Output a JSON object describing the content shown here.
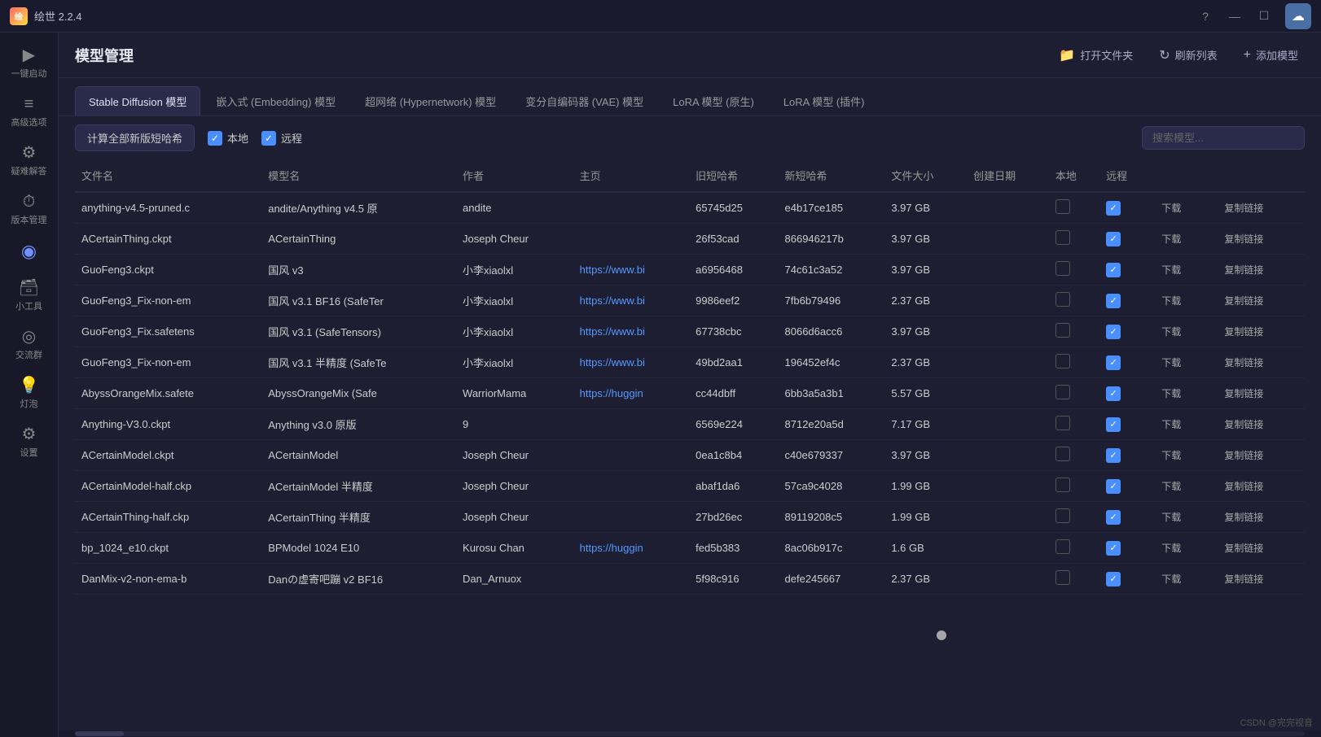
{
  "titlebar": {
    "title": "绘世 2.2.4",
    "controls": [
      "?",
      "—",
      "☐"
    ]
  },
  "sidebar": {
    "items": [
      {
        "id": "launch",
        "icon": "▶",
        "label": "一键启动"
      },
      {
        "id": "advanced",
        "icon": "≡",
        "label": "高级选项"
      },
      {
        "id": "troubleshoot",
        "icon": "⚙",
        "label": "疑难解答"
      },
      {
        "id": "version",
        "icon": "⏱",
        "label": "版本管理"
      },
      {
        "id": "models",
        "icon": "◉",
        "label": "",
        "active": true
      },
      {
        "id": "tools",
        "icon": "🗃",
        "label": "小工具"
      },
      {
        "id": "community",
        "icon": "◎",
        "label": "交流群"
      },
      {
        "id": "ideas",
        "icon": "💡",
        "label": "灯泡"
      },
      {
        "id": "settings",
        "icon": "⚙",
        "label": "设置"
      }
    ]
  },
  "header": {
    "title": "模型管理",
    "actions": [
      {
        "id": "open-folder",
        "icon": "📁",
        "label": "打开文件夹"
      },
      {
        "id": "refresh",
        "icon": "↻",
        "label": "刷新列表"
      },
      {
        "id": "add-model",
        "icon": "+",
        "label": "添加模型"
      }
    ]
  },
  "tabs": [
    {
      "id": "stable-diffusion",
      "label": "Stable Diffusion 模型",
      "active": true
    },
    {
      "id": "embedding",
      "label": "嵌入式 (Embedding) 模型"
    },
    {
      "id": "hypernetwork",
      "label": "超网络 (Hypernetwork) 模型"
    },
    {
      "id": "vae",
      "label": "变分自编码器 (VAE) 模型"
    },
    {
      "id": "lora-native",
      "label": "LoRA 模型 (原生)"
    },
    {
      "id": "lora-plugin",
      "label": "LoRA 模型 (插件)"
    }
  ],
  "toolbar": {
    "calc_btn": "计算全部新版短哈希",
    "local_label": "本地",
    "remote_label": "远程",
    "search_placeholder": "搜索模型..."
  },
  "table": {
    "columns": [
      "文件名",
      "模型名",
      "作者",
      "主页",
      "旧短哈希",
      "新短哈希",
      "文件大小",
      "创建日期",
      "本地",
      "远程",
      "",
      ""
    ],
    "rows": [
      {
        "filename": "anything-v4.5-pruned.c",
        "modelname": "andite/Anything v4.5 原",
        "author": "andite",
        "homepage": "",
        "old_hash": "65745d25",
        "new_hash": "e4b17ce185",
        "size": "3.97 GB",
        "date": "",
        "local": false,
        "remote": true
      },
      {
        "filename": "ACertainThing.ckpt",
        "modelname": "ACertainThing",
        "author": "Joseph Cheur",
        "homepage": "",
        "old_hash": "26f53cad",
        "new_hash": "866946217b",
        "size": "3.97 GB",
        "date": "",
        "local": false,
        "remote": true
      },
      {
        "filename": "GuoFeng3.ckpt",
        "modelname": "国风 v3",
        "author": "小李xiaolxl",
        "homepage": "https://www.bi",
        "old_hash": "a6956468",
        "new_hash": "74c61c3a52",
        "size": "3.97 GB",
        "date": "",
        "local": false,
        "remote": true
      },
      {
        "filename": "GuoFeng3_Fix-non-em",
        "modelname": "国风 v3.1 BF16 (SafeTer",
        "author": "小李xiaolxl",
        "homepage": "https://www.bi",
        "old_hash": "9986eef2",
        "new_hash": "7fb6b79496",
        "size": "2.37 GB",
        "date": "",
        "local": false,
        "remote": true
      },
      {
        "filename": "GuoFeng3_Fix.safetens",
        "modelname": "国风 v3.1 (SafeTensors)",
        "author": "小李xiaolxl",
        "homepage": "https://www.bi",
        "old_hash": "67738cbc",
        "new_hash": "8066d6acc6",
        "size": "3.97 GB",
        "date": "",
        "local": false,
        "remote": true
      },
      {
        "filename": "GuoFeng3_Fix-non-em",
        "modelname": "国风 v3.1 半精度 (SafeTe",
        "author": "小李xiaolxl",
        "homepage": "https://www.bi",
        "old_hash": "49bd2aa1",
        "new_hash": "196452ef4c",
        "size": "2.37 GB",
        "date": "",
        "local": false,
        "remote": true
      },
      {
        "filename": "AbyssOrangeMix.safete",
        "modelname": "AbyssOrangeMix (Safe",
        "author": "WarriorMama",
        "homepage": "https://huggin",
        "old_hash": "cc44dbff",
        "new_hash": "6bb3a5a3b1",
        "size": "5.57 GB",
        "date": "",
        "local": false,
        "remote": true
      },
      {
        "filename": "Anything-V3.0.ckpt",
        "modelname": "Anything v3.0 原版",
        "author": "9",
        "homepage": "",
        "old_hash": "6569e224",
        "new_hash": "8712e20a5d",
        "size": "7.17 GB",
        "date": "",
        "local": false,
        "remote": true
      },
      {
        "filename": "ACertainModel.ckpt",
        "modelname": "ACertainModel",
        "author": "Joseph Cheur",
        "homepage": "",
        "old_hash": "0ea1c8b4",
        "new_hash": "c40e679337",
        "size": "3.97 GB",
        "date": "",
        "local": false,
        "remote": true
      },
      {
        "filename": "ACertainModel-half.ckp",
        "modelname": "ACertainModel 半精度",
        "author": "Joseph Cheur",
        "homepage": "",
        "old_hash": "abaf1da6",
        "new_hash": "57ca9c4028",
        "size": "1.99 GB",
        "date": "",
        "local": false,
        "remote": true
      },
      {
        "filename": "ACertainThing-half.ckp",
        "modelname": "ACertainThing 半精度",
        "author": "Joseph Cheur",
        "homepage": "",
        "old_hash": "27bd26ec",
        "new_hash": "89119208c5",
        "size": "1.99 GB",
        "date": "",
        "local": false,
        "remote": true
      },
      {
        "filename": "bp_1024_e10.ckpt",
        "modelname": "BPModel 1024 E10",
        "author": "Kurosu Chan",
        "homepage": "https://huggin",
        "old_hash": "fed5b383",
        "new_hash": "8ac06b917c",
        "size": "1.6 GB",
        "date": "",
        "local": false,
        "remote": true
      },
      {
        "filename": "DanMix-v2-non-ema-b",
        "modelname": "Danの虚寄吧蹦 v2 BF16",
        "author": "Dan_Arnuox",
        "homepage": "",
        "old_hash": "5f98c916",
        "new_hash": "defe245667",
        "size": "2.37 GB",
        "date": "",
        "local": false,
        "remote": true
      }
    ],
    "action_download": "下载",
    "action_copy": "复制链接"
  },
  "watermark": "CSDN @完完视音"
}
